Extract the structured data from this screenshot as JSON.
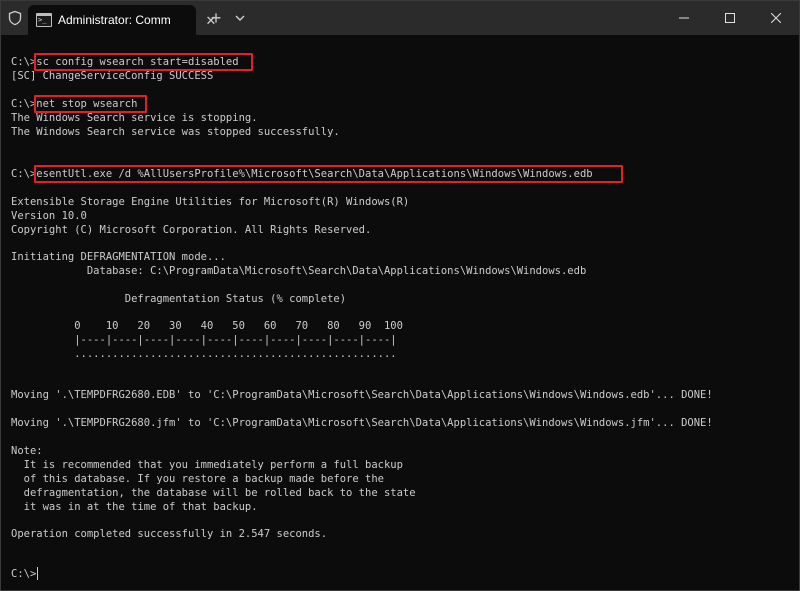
{
  "window": {
    "tab_title": "Administrator: Command Pror",
    "tab_close_icon": "close-icon",
    "new_tab_icon": "plus-icon",
    "dropdown_icon": "chevron-down-icon",
    "shield_icon": "shield-icon",
    "minimize_icon": "minimize-icon",
    "maximize_icon": "maximize-icon",
    "close_icon": "close-icon"
  },
  "terminal": {
    "lines": [
      "C:\\>sc config wsearch start=disabled",
      "[SC] ChangeServiceConfig SUCCESS",
      "C:\\>net stop wsearch",
      "The Windows Search service is stopping.",
      "The Windows Search service was stopped successfully.",
      "C:\\>esentUtl.exe /d %AllUsersProfile%\\Microsoft\\Search\\Data\\Applications\\Windows\\Windows.edb",
      "Extensible Storage Engine Utilities for Microsoft(R) Windows(R)",
      "Version 10.0",
      "Copyright (C) Microsoft Corporation. All Rights Reserved.",
      "Initiating DEFRAGMENTATION mode...",
      "            Database: C:\\ProgramData\\Microsoft\\Search\\Data\\Applications\\Windows\\Windows.edb",
      "                  Defragmentation Status (% complete)",
      "          0    10   20   30   40   50   60   70   80   90  100",
      "          |----|----|----|----|----|----|----|----|----|----|",
      "          ...................................................",
      "Moving '.\\TEMPDFRG2680.EDB' to 'C:\\ProgramData\\Microsoft\\Search\\Data\\Applications\\Windows\\Windows.edb'... DONE!",
      "Moving '.\\TEMPDFRG2680.jfm' to 'C:\\ProgramData\\Microsoft\\Search\\Data\\Applications\\Windows\\Windows.jfm'... DONE!",
      "Note:",
      "  It is recommended that you immediately perform a full backup",
      "  of this database. If you restore a backup made before the",
      "  defragmentation, the database will be rolled back to the state",
      "  it was in at the time of that backup.",
      "Operation completed successfully in 2.547 seconds.",
      "C:\\>"
    ]
  },
  "colors": {
    "background": "#0c0c0c",
    "text": "#cccccc",
    "highlight": "#e0202a",
    "titlebar": "#2b2b2b"
  }
}
